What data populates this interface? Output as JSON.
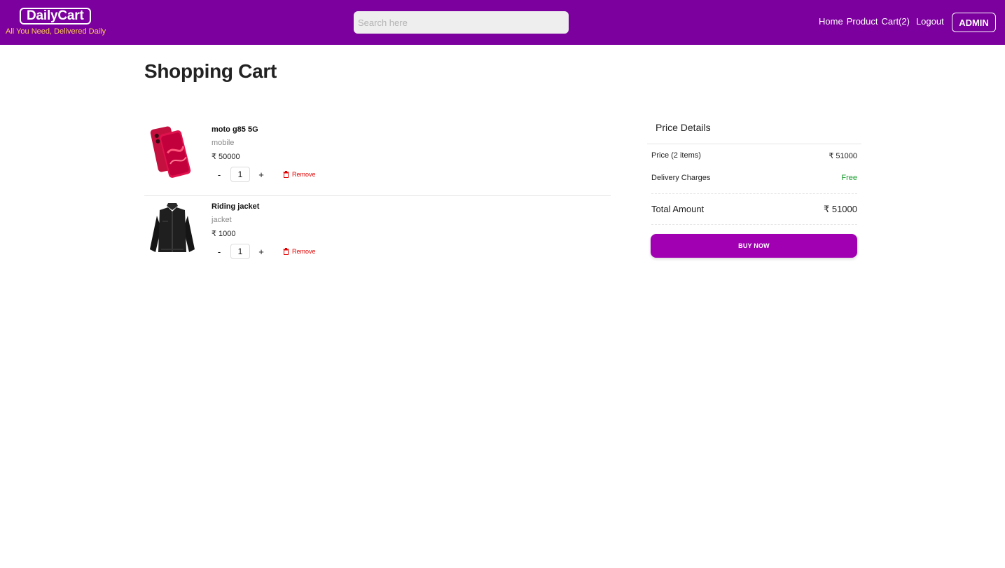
{
  "header": {
    "logo": "DailyCart",
    "tagline": "All You Need, Delivered Daily",
    "search_placeholder": "Search here",
    "nav": {
      "home": "Home",
      "product": "Product",
      "cart": "Cart(2)",
      "logout": "Logout",
      "admin": "ADMIN"
    },
    "colors": {
      "bar": "#7b009d",
      "tagline": "#ffd04d"
    }
  },
  "page": {
    "title": "Shopping Cart"
  },
  "cart": {
    "items": [
      {
        "name": "moto g85 5G",
        "category": "mobile",
        "price": "₹ 50000",
        "qty": "1",
        "image": "phone-image"
      },
      {
        "name": "Riding jacket",
        "category": "jacket",
        "price": "₹ 1000",
        "qty": "1",
        "image": "jacket-image"
      }
    ],
    "qty_minus": "-",
    "qty_plus": "+",
    "remove_label": "Remove"
  },
  "price_details": {
    "heading": "Price Details",
    "price_label": "Price (2 items)",
    "price_value": "₹ 51000",
    "delivery_label": "Delivery Charges",
    "delivery_value": "Free",
    "total_label": "Total Amount",
    "total_value": "₹ 51000",
    "buy_label": "BUY NOW",
    "colors": {
      "buy_button": "#a100b2",
      "free": "#1a9c2e",
      "remove": "#e00000"
    }
  }
}
